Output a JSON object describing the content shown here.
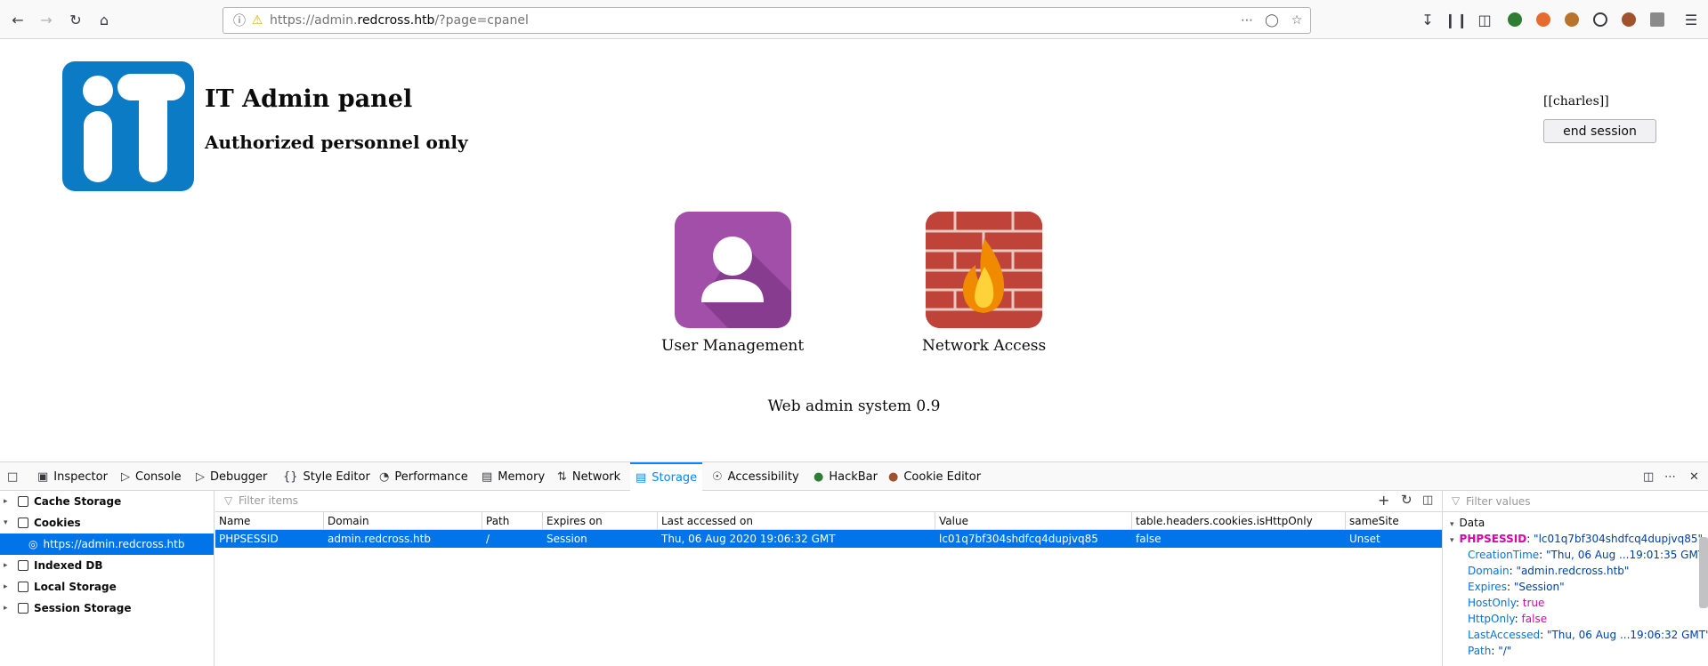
{
  "browser": {
    "url_prefix": "https://admin.",
    "url_domain": "redcross.htb",
    "url_path": "/?page=cpanel"
  },
  "page": {
    "title": "IT Admin panel",
    "subtitle": "Authorized personnel only",
    "user": "[[charles]]",
    "end_session": "end session",
    "apps": [
      {
        "label": "User Management"
      },
      {
        "label": "Network Access"
      }
    ],
    "footer": "Web admin system 0.9"
  },
  "devtools": {
    "tabs": [
      "Inspector",
      "Console",
      "Debugger",
      "Style Editor",
      "Performance",
      "Memory",
      "Network",
      "Storage",
      "Accessibility",
      "HackBar",
      "Cookie Editor"
    ],
    "active_tab": "Storage",
    "tree": [
      "Cache Storage",
      "Cookies",
      "https://admin.redcross.htb",
      "Indexed DB",
      "Local Storage",
      "Session Storage"
    ],
    "filter_placeholder": "Filter items",
    "filter_values_placeholder": "Filter values",
    "columns": [
      "Name",
      "Domain",
      "Path",
      "Expires on",
      "Last accessed on",
      "Value",
      "table.headers.cookies.isHttpOnly",
      "sameSite"
    ],
    "row": [
      "PHPSESSID",
      "admin.redcross.htb",
      "/",
      "Session",
      "Thu, 06 Aug 2020 19:06:32 GMT",
      "lc01q7bf304shdfcq4dupjvq85",
      "false",
      "Unset"
    ],
    "sidebar": {
      "header": "Data",
      "root_key": "PHPSESSID",
      "root_value": "\"lc01q7bf304shdfcq4dupjvq85\"",
      "items": [
        {
          "k": "CreationTime",
          "v": "\"Thu, 06 Aug ...19:01:35 GMT\""
        },
        {
          "k": "Domain",
          "v": "\"admin.redcross.htb\""
        },
        {
          "k": "Expires",
          "v": "\"Session\""
        },
        {
          "k": "HostOnly",
          "v": "true"
        },
        {
          "k": "HttpOnly",
          "v": "false"
        },
        {
          "k": "LastAccessed",
          "v": "\"Thu, 06 Aug ...19:06:32 GMT\""
        },
        {
          "k": "Path",
          "v": "\"/\""
        }
      ]
    }
  }
}
